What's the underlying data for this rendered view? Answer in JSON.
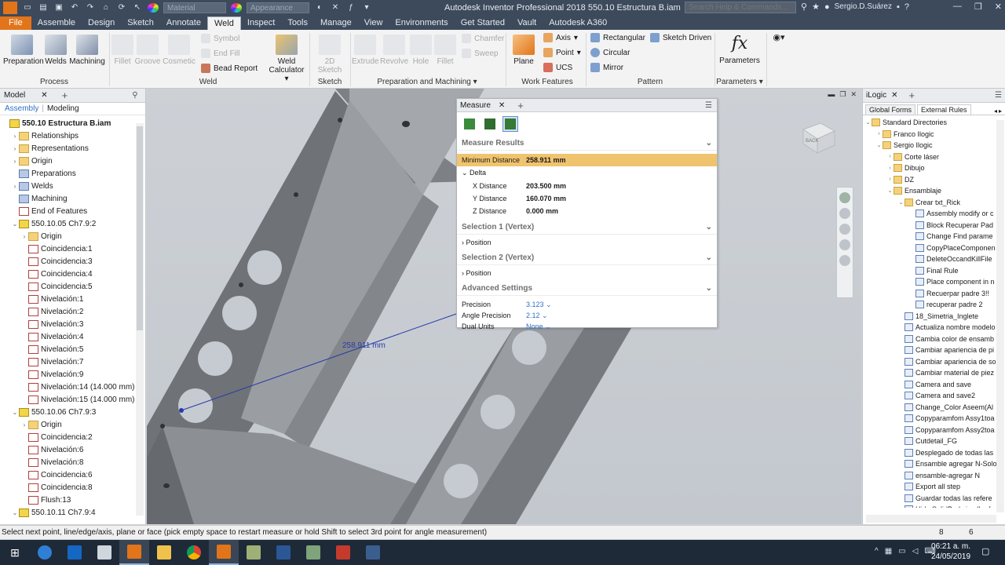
{
  "titlebar": {
    "app_icon": "inventor-pro-logo",
    "material_placeholder": "Material",
    "appearance_placeholder": "Appearance",
    "title": "Autodesk Inventor Professional 2018    550.10 Estructura B.iam",
    "search_placeholder": "Search Help & Commands...",
    "user": "Sergio.D.Suárez",
    "help": "?"
  },
  "tabs": [
    "File",
    "Assemble",
    "Design",
    "Sketch",
    "Annotate",
    "Weld",
    "Inspect",
    "Tools",
    "Manage",
    "View",
    "Environments",
    "Get Started",
    "Vault",
    "Autodesk A360"
  ],
  "active_tab": "Weld",
  "ribbon": {
    "process": {
      "label": "Process",
      "preparation": "Preparation",
      "welds": "Welds",
      "machining": "Machining"
    },
    "weld": {
      "label": "Weld",
      "fillet": "Fillet",
      "groove": "Groove",
      "cosmetic": "Cosmetic",
      "symbol": "Symbol",
      "end_fill": "End Fill",
      "bead_report": "Bead Report",
      "weld_calculator_1": "Weld",
      "weld_calculator_2": "Calculator"
    },
    "sketch": {
      "label": "Sketch",
      "sketch2d": "2D Sketch"
    },
    "prep_mach": {
      "label": "Preparation and Machining",
      "extrude": "Extrude",
      "revolve": "Revolve",
      "hole": "Hole",
      "fillet": "Fillet",
      "chamfer": "Chamfer",
      "sweep": "Sweep"
    },
    "work_features": {
      "label": "Work Features",
      "plane": "Plane",
      "axis": "Axis",
      "point": "Point",
      "ucs": "UCS"
    },
    "pattern": {
      "label": "Pattern",
      "rectangular": "Rectangular",
      "circular": "Circular",
      "mirror": "Mirror",
      "sketch_driven": "Sketch Driven"
    },
    "parameters": {
      "label": "Parameters",
      "parameters": "Parameters",
      "fx": "fx"
    }
  },
  "left_panel": {
    "tab": "Model",
    "mode_assembly": "Assembly",
    "mode_modeling": "Modeling",
    "tree": [
      {
        "label": "550.10 Estructura B.iam",
        "level": 0,
        "icon": "asm",
        "bold": true,
        "exp": ""
      },
      {
        "label": "Relationships",
        "level": 1,
        "icon": "fold",
        "exp": "›"
      },
      {
        "label": "Representations",
        "level": 1,
        "icon": "fold",
        "exp": "›"
      },
      {
        "label": "Origin",
        "level": 1,
        "icon": "fold",
        "exp": "›"
      },
      {
        "label": "Preparations",
        "level": 1,
        "icon": "prt",
        "exp": ""
      },
      {
        "label": "Welds",
        "level": 1,
        "icon": "prt",
        "exp": "›"
      },
      {
        "label": "Machining",
        "level": 1,
        "icon": "prt",
        "exp": ""
      },
      {
        "label": "End of Features",
        "level": 1,
        "icon": "con",
        "exp": ""
      },
      {
        "label": "550.10.05 Ch7.9:2",
        "level": 1,
        "icon": "asm",
        "exp": "⌄"
      },
      {
        "label": "Origin",
        "level": 2,
        "icon": "fold",
        "exp": "›"
      },
      {
        "label": "Coincidencia:1",
        "level": 2,
        "icon": "con",
        "exp": ""
      },
      {
        "label": "Coincidencia:3",
        "level": 2,
        "icon": "con",
        "exp": ""
      },
      {
        "label": "Coincidencia:4",
        "level": 2,
        "icon": "con",
        "exp": ""
      },
      {
        "label": "Coincidencia:5",
        "level": 2,
        "icon": "con",
        "exp": ""
      },
      {
        "label": "Nivelación:1",
        "level": 2,
        "icon": "con",
        "exp": ""
      },
      {
        "label": "Nivelación:2",
        "level": 2,
        "icon": "con",
        "exp": ""
      },
      {
        "label": "Nivelación:3",
        "level": 2,
        "icon": "con",
        "exp": ""
      },
      {
        "label": "Nivelación:4",
        "level": 2,
        "icon": "con",
        "exp": ""
      },
      {
        "label": "Nivelación:5",
        "level": 2,
        "icon": "con",
        "exp": ""
      },
      {
        "label": "Nivelación:7",
        "level": 2,
        "icon": "con",
        "exp": ""
      },
      {
        "label": "Nivelación:9",
        "level": 2,
        "icon": "con",
        "exp": ""
      },
      {
        "label": "Nivelación:14 (14.000 mm)",
        "level": 2,
        "icon": "con",
        "exp": ""
      },
      {
        "label": "Nivelación:15 (14.000 mm)",
        "level": 2,
        "icon": "con",
        "exp": ""
      },
      {
        "label": "550.10.06 Ch7.9:3",
        "level": 1,
        "icon": "asm",
        "exp": "⌄"
      },
      {
        "label": "Origin",
        "level": 2,
        "icon": "fold",
        "exp": "›"
      },
      {
        "label": "Coincidencia:2",
        "level": 2,
        "icon": "con",
        "exp": ""
      },
      {
        "label": "Nivelación:6",
        "level": 2,
        "icon": "con",
        "exp": ""
      },
      {
        "label": "Nivelación:8",
        "level": 2,
        "icon": "con",
        "exp": ""
      },
      {
        "label": "Coincidencia:6",
        "level": 2,
        "icon": "con",
        "exp": ""
      },
      {
        "label": "Coincidencia:8",
        "level": 2,
        "icon": "con",
        "exp": ""
      },
      {
        "label": "Flush:13",
        "level": 2,
        "icon": "con",
        "exp": ""
      },
      {
        "label": "550.10.11 Ch7.9:4",
        "level": 1,
        "icon": "asm",
        "exp": "⌄"
      }
    ]
  },
  "viewport": {
    "dimension_label": "258.911 mm",
    "viewcube_face": "BACK"
  },
  "measure": {
    "tab": "Measure",
    "results_header": "Measure Results",
    "min_distance_label": "Minimum Distance",
    "min_distance_value": "258.911 mm",
    "delta_label": "Delta",
    "x_label": "X Distance",
    "x_value": "203.500 mm",
    "y_label": "Y Distance",
    "y_value": "160.070 mm",
    "z_label": "Z Distance",
    "z_value": "0.000 mm",
    "sel1": "Selection 1 (Vertex)",
    "sel2": "Selection 2 (Vertex)",
    "position": "Position",
    "advanced": "Advanced Settings",
    "precision_label": "Precision",
    "precision_value": "3.123",
    "angle_label": "Angle Precision",
    "angle_value": "2.12",
    "dual_label": "Dual Units",
    "dual_value": "None"
  },
  "right_panel": {
    "tab": "iLogic",
    "tab_global": "Global Forms",
    "tab_external": "External Rules",
    "tree": [
      {
        "label": "Standard Directories",
        "level": 0,
        "icon": "fold",
        "exp": "⌄"
      },
      {
        "label": "Franco Ilogic",
        "level": 1,
        "icon": "fold",
        "exp": "›"
      },
      {
        "label": "Sergio Ilogic",
        "level": 1,
        "icon": "fold",
        "exp": "⌄"
      },
      {
        "label": "Corte láser",
        "level": 2,
        "icon": "fold",
        "exp": "›"
      },
      {
        "label": "Dibujo",
        "level": 2,
        "icon": "fold",
        "exp": "›"
      },
      {
        "label": "DZ",
        "level": 2,
        "icon": "fold",
        "exp": "›"
      },
      {
        "label": "Ensamblaje",
        "level": 2,
        "icon": "fold",
        "exp": "⌄"
      },
      {
        "label": "Crear txt_Rick",
        "level": 3,
        "icon": "fold",
        "exp": "⌄"
      },
      {
        "label": "Assembly modify or c",
        "level": 4,
        "icon": "rule",
        "exp": ""
      },
      {
        "label": "Block Recuperar Pad",
        "level": 4,
        "icon": "rule",
        "exp": ""
      },
      {
        "label": "Change Find parame",
        "level": 4,
        "icon": "rule",
        "exp": ""
      },
      {
        "label": "CopyPlaceComponen",
        "level": 4,
        "icon": "rule",
        "exp": ""
      },
      {
        "label": "DeleteOccandKillFile",
        "level": 4,
        "icon": "rule",
        "exp": ""
      },
      {
        "label": "Final Rule",
        "level": 4,
        "icon": "rule",
        "exp": ""
      },
      {
        "label": "Place component in n",
        "level": 4,
        "icon": "rule",
        "exp": ""
      },
      {
        "label": "Recuerpar padre 3!!",
        "level": 4,
        "icon": "rule",
        "exp": ""
      },
      {
        "label": "recuperar padre 2",
        "level": 4,
        "icon": "rule",
        "exp": ""
      },
      {
        "label": "18_Simetria_Inglete",
        "level": 3,
        "icon": "rule",
        "exp": ""
      },
      {
        "label": "Actualiza nombre modelo",
        "level": 3,
        "icon": "rule",
        "exp": ""
      },
      {
        "label": "Cambia color de ensamb",
        "level": 3,
        "icon": "rule",
        "exp": ""
      },
      {
        "label": "Cambiar apariencia de pi",
        "level": 3,
        "icon": "rule",
        "exp": ""
      },
      {
        "label": "Cambiar apariencia de so",
        "level": 3,
        "icon": "rule",
        "exp": ""
      },
      {
        "label": "Cambiar material de piez",
        "level": 3,
        "icon": "rule",
        "exp": ""
      },
      {
        "label": "Camera and save",
        "level": 3,
        "icon": "rule",
        "exp": ""
      },
      {
        "label": "Camera and save2",
        "level": 3,
        "icon": "rule",
        "exp": ""
      },
      {
        "label": "Change_Color Aseem(Al",
        "level": 3,
        "icon": "rule",
        "exp": ""
      },
      {
        "label": "Copyparamfom Assy1toa",
        "level": 3,
        "icon": "rule",
        "exp": ""
      },
      {
        "label": "Copyparamfom Assy2toa",
        "level": 3,
        "icon": "rule",
        "exp": ""
      },
      {
        "label": "Cutdetail_FG",
        "level": 3,
        "icon": "rule",
        "exp": ""
      },
      {
        "label": "Desplegado de todas las",
        "level": 3,
        "icon": "rule",
        "exp": ""
      },
      {
        "label": "Ensamble agregar N-Solo",
        "level": 3,
        "icon": "rule",
        "exp": ""
      },
      {
        "label": "ensamble-agregar N",
        "level": 3,
        "icon": "rule",
        "exp": ""
      },
      {
        "label": "Export all step",
        "level": 3,
        "icon": "rule",
        "exp": ""
      },
      {
        "label": "Guardar todas las refere",
        "level": 3,
        "icon": "rule",
        "exp": ""
      },
      {
        "label": "Hide SolidBody in all refe",
        "level": 3,
        "icon": "rule",
        "exp": ""
      }
    ]
  },
  "status": {
    "message": "Select next point, line/edge/axis, plane or face (pick empty space to restart measure or hold Shift to select 3rd point for angle measurement)",
    "n1": "8",
    "n2": "6"
  },
  "taskbar": {
    "apps": [
      "start",
      "edge",
      "outlook",
      "photoshop",
      "inventor",
      "explorer",
      "chrome",
      "inventor2",
      "app",
      "word",
      "app2",
      "acrobat",
      "photos"
    ],
    "time": "06:21 a. m.",
    "date": "24/05/2019"
  },
  "colors": {
    "accent": "#e2741a",
    "titlebar": "#3c4a5c",
    "highlight": "#f0c46e",
    "link": "#2f6fc7",
    "dimension": "#2a3aa6"
  }
}
